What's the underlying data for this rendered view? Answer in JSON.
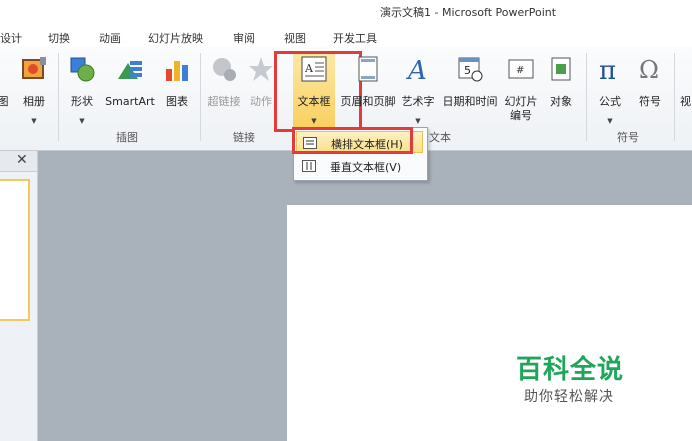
{
  "window": {
    "title": "演示文稿1 - Microsoft PowerPoint"
  },
  "tabs": [
    "设计",
    "切换",
    "动画",
    "幻灯片放映",
    "审阅",
    "视图",
    "开发工具"
  ],
  "ribbon": {
    "buttons": {
      "picture": "图",
      "album": "相册",
      "shape": "形状",
      "smartart": "SmartArt",
      "chart": "图表",
      "hyperlink": "超链接",
      "action": "动作",
      "textbox": "文本框",
      "header_footer": "页眉和页脚",
      "wordart": "艺术字",
      "datetime": "日期和时间",
      "slide_number_line1": "幻灯片",
      "slide_number_line2": "编号",
      "object": "对象",
      "equation": "公式",
      "symbol": "符号",
      "more": "视"
    },
    "groups": {
      "illustrations": "插图",
      "links": "链接",
      "text": "文本",
      "symbols": "符号"
    }
  },
  "dropdown": {
    "horizontal": "横排文本框(H)",
    "vertical": "垂直文本框(V)"
  },
  "panel": {
    "close_glyph": "✕"
  },
  "watermark": {
    "title": "百科全说",
    "subtitle": "助你轻松解决"
  }
}
